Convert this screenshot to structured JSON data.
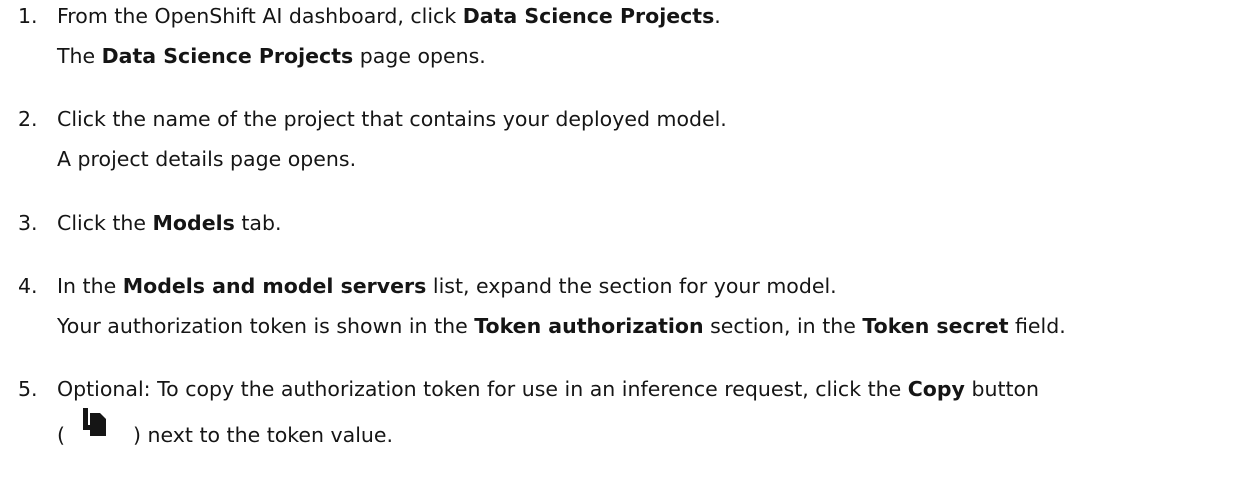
{
  "steps": [
    {
      "number": "1.",
      "line1": {
        "pre": "From the OpenShift AI dashboard, click ",
        "bold": "Data Science Projects",
        "post": "."
      },
      "line2": {
        "pre": "The ",
        "bold": "Data Science Projects",
        "post": " page opens."
      }
    },
    {
      "number": "2.",
      "line1": "Click the name of the project that contains your deployed model.",
      "line2": "A project details page opens."
    },
    {
      "number": "3.",
      "line1": {
        "pre": "Click the ",
        "bold": "Models",
        "post": " tab."
      }
    },
    {
      "number": "4.",
      "line1": {
        "pre": "In the ",
        "bold": "Models and model servers",
        "post": " list, expand the section for your model."
      },
      "line2": {
        "pre": "Your authorization token is shown in the ",
        "bold1": "Token authorization",
        "mid": " section, in the ",
        "bold2": "Token secret",
        "post": " field."
      }
    },
    {
      "number": "5.",
      "line1": {
        "pre": "Optional: To copy the authorization token for use in an inference request, click the ",
        "bold": "Copy",
        "post": " button"
      },
      "line2": {
        "pre": "(",
        "icon": "copy-icon",
        "post": ") next to the token value."
      }
    }
  ]
}
